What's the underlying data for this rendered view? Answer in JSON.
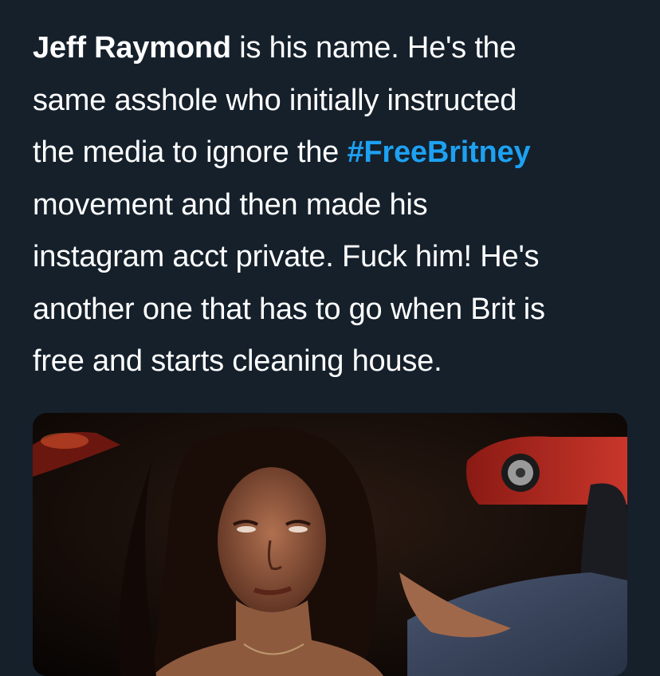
{
  "tweet": {
    "lines": [
      [
        {
          "text": "Jeff Raymond",
          "style": "bold"
        },
        {
          "text": " is his name. He's the",
          "style": "normal"
        }
      ],
      [
        {
          "text": "same asshole who initially instructed",
          "style": "normal"
        }
      ],
      [
        {
          "text": "the media to ignore the ",
          "style": "normal"
        },
        {
          "text": "#FreeBritney",
          "style": "hashtag"
        }
      ],
      [
        {
          "text": "movement and then made his",
          "style": "normal"
        }
      ],
      [
        {
          "text": "instagram acct private. Fuck him! He's",
          "style": "normal"
        }
      ],
      [
        {
          "text": "another one that has to go when Brit is",
          "style": "normal"
        }
      ],
      [
        {
          "text": "free and starts cleaning house.",
          "style": "normal"
        }
      ]
    ],
    "hashtag_color": "#1da1f2",
    "text_color": "#ffffff",
    "background": "#15202b"
  },
  "media": {
    "kind": "gif-thumbnail",
    "description_icon": "photo-media"
  }
}
